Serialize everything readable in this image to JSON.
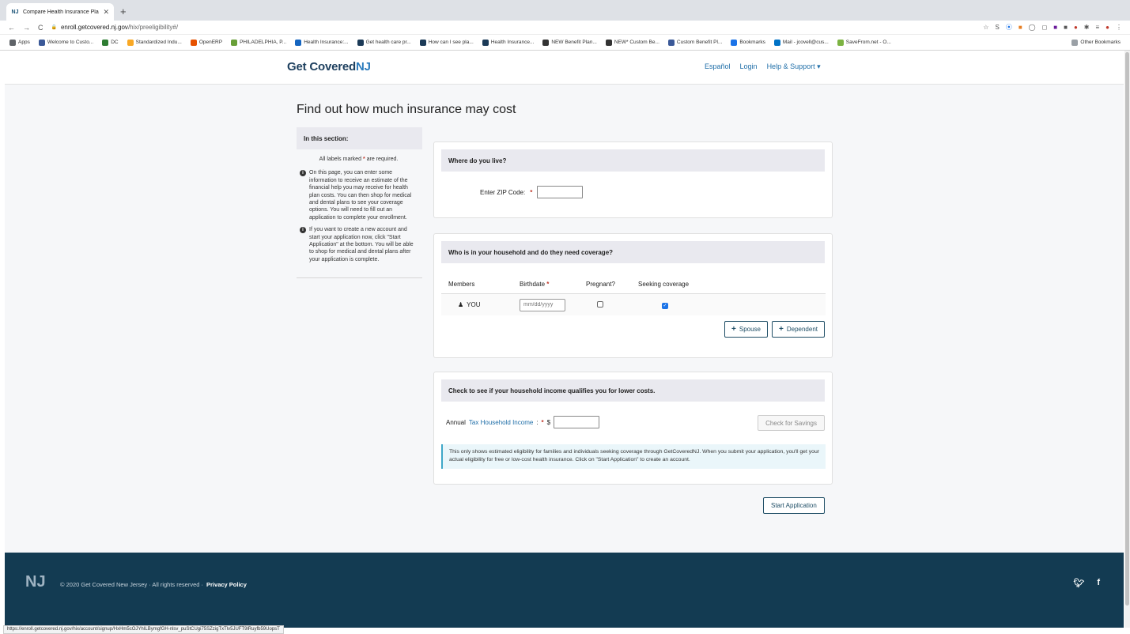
{
  "browser": {
    "tab_title": "Compare Health Insurance Pla",
    "tab_favicon": "NJ",
    "url_domain": "enroll.getcovered.nj.gov",
    "url_path": "/hix/preeligibility#/",
    "bookmarks": [
      {
        "label": "Apps",
        "color": "#5f6368"
      },
      {
        "label": "Welcome to Custo...",
        "color": "#3b5998"
      },
      {
        "label": "DC",
        "color": "#2e7d32"
      },
      {
        "label": "Standardized Indu...",
        "color": "#f9a825"
      },
      {
        "label": "OpenERP",
        "color": "#e65100"
      },
      {
        "label": "PHILADELPHIA, P...",
        "color": "#689f38"
      },
      {
        "label": "Health Insurance:...",
        "color": "#1565c0"
      },
      {
        "label": "Get health care pr...",
        "color": "#1b3a57"
      },
      {
        "label": "How can I see pla...",
        "color": "#1b3a57"
      },
      {
        "label": "Health Insurance...",
        "color": "#1b3a57"
      },
      {
        "label": "NEW Benefit Plan...",
        "color": "#333333"
      },
      {
        "label": "NEW* Custom Be...",
        "color": "#333333"
      },
      {
        "label": "Custom Benefit Pl...",
        "color": "#3b5998"
      },
      {
        "label": "Bookmarks",
        "color": "#1a73e8"
      },
      {
        "label": "Mail - jcovell@cus...",
        "color": "#0072c6"
      },
      {
        "label": "SaveFrom.net - O...",
        "color": "#7cb342"
      }
    ],
    "other_bookmarks": "Other Bookmarks",
    "status_url": "https://enroll.getcovered.nj.gov/hix/account/signup/HxHm5cOJYhILBymgfGH-nlsv_puStCUgi75SZzigTxTlv5JUFT9lRuyfb59UopsT"
  },
  "header": {
    "logo_text": "Get Covered",
    "logo_mark": "NJ",
    "nav": [
      "Español",
      "Login",
      "Help & Support ▾"
    ]
  },
  "main": {
    "title": "Find out how much insurance may cost"
  },
  "sidebar": {
    "heading": "In this section:",
    "required_prefix": "All labels marked",
    "required_suffix": "are required.",
    "paragraphs": [
      "On this page, you can enter some information to receive an estimate of the financial help you may receive for health plan costs. You can then shop for medical and dental plans to see your coverage options. You will need to fill out an application to complete your enrollment.",
      "If you want to create a new account and start your application now, click \"Start Application\" at the bottom. You will be able to shop for medical and dental plans after your application is complete."
    ]
  },
  "location": {
    "heading": "Where do you live?",
    "zip_label": "Enter ZIP Code:",
    "zip_value": ""
  },
  "household": {
    "heading": "Who is in your household and do they need coverage?",
    "columns": [
      "Members",
      "Birthdate",
      "Pregnant?",
      "Seeking coverage"
    ],
    "member_name": "YOU",
    "birthdate_placeholder": "mm/dd/yyyy",
    "pregnant": false,
    "seeking_coverage": true,
    "add_spouse": "Spouse",
    "add_dependent": "Dependent"
  },
  "income": {
    "heading": "Check to see if your household income qualifies you for lower costs.",
    "label_prefix": "Annual",
    "label_link": "Tax Household Income",
    "currency": "$",
    "value": "",
    "check_button": "Check for Savings",
    "notice": "This only shows estimated eligibility for families and individuals seeking coverage through GetCoveredNJ. When you submit your application, you'll get your actual eligibility for free or low-cost health insurance. Click on \"Start Application\" to create an account."
  },
  "start_button": "Start Application",
  "footer": {
    "logo": "NJ",
    "copyright": "© 2020 Get Covered New Jersey · All rights reserved ·",
    "privacy": "Privacy Policy",
    "social": [
      "twitter",
      "facebook"
    ]
  }
}
